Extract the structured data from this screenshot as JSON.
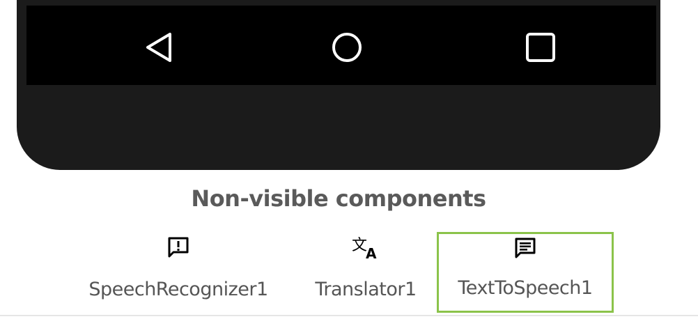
{
  "phone": {
    "nav_icons": [
      "back-triangle-icon",
      "home-circle-icon",
      "recents-square-icon"
    ]
  },
  "non_visible": {
    "title": "Non-visible components",
    "components": [
      {
        "label": "SpeechRecognizer1",
        "icon": "speech-recognizer-icon",
        "selected": false
      },
      {
        "label": "Translator1",
        "icon": "translate-icon",
        "selected": false
      },
      {
        "label": "TextToSpeech1",
        "icon": "text-to-speech-icon",
        "selected": true
      }
    ]
  },
  "colors": {
    "selection_border": "#8bc34a",
    "phone_body": "#1b1b1b",
    "navbar": "#000000",
    "label_text": "#555555"
  }
}
